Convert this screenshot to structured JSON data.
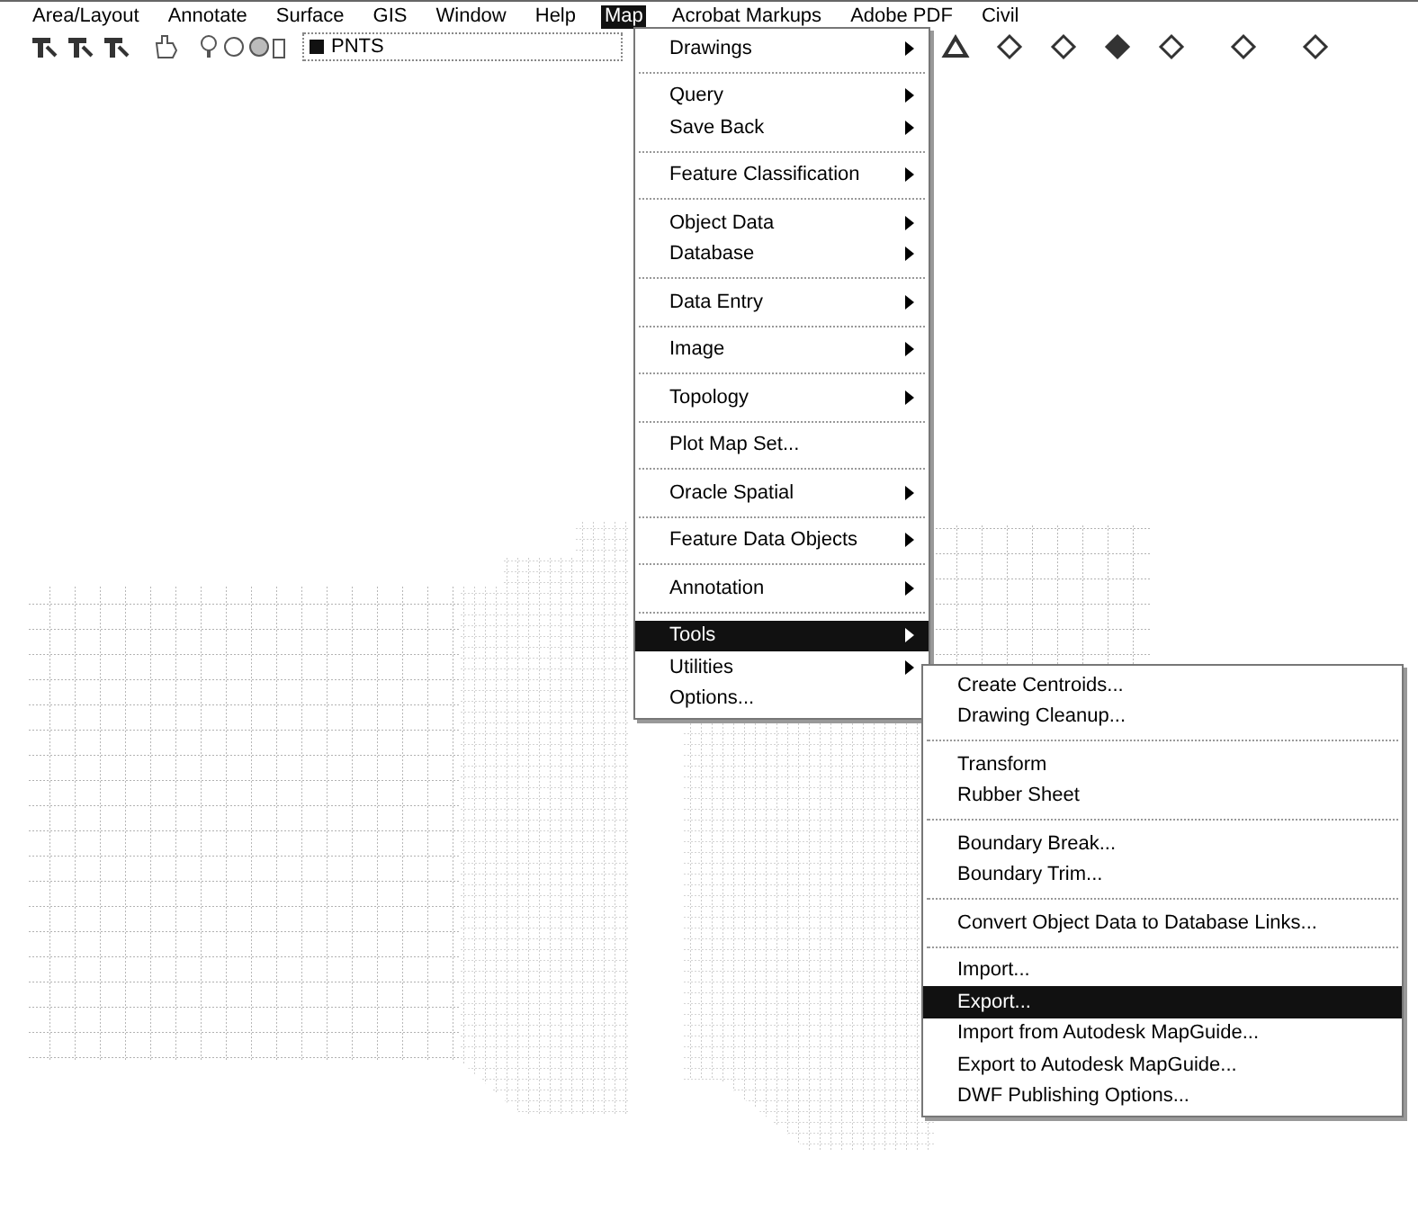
{
  "menubar": [
    {
      "label": "Area/Layout",
      "selected": false
    },
    {
      "label": "Annotate",
      "selected": false
    },
    {
      "label": "Surface",
      "selected": false
    },
    {
      "label": "GIS",
      "selected": false
    },
    {
      "label": "Window",
      "selected": false
    },
    {
      "label": "Help",
      "selected": false
    },
    {
      "label": "Map",
      "selected": true
    },
    {
      "label": "Acrobat Markups",
      "selected": false
    },
    {
      "label": "Adobe PDF",
      "selected": false
    },
    {
      "label": "Civil",
      "selected": false
    }
  ],
  "toolbar": {
    "layer": "PNTS"
  },
  "map_menu": [
    {
      "items": [
        {
          "label": "Drawings",
          "submenu": true,
          "selected": false
        }
      ]
    },
    {
      "items": [
        {
          "label": "Query",
          "submenu": true,
          "selected": false
        },
        {
          "label": "Save Back",
          "submenu": true,
          "selected": false
        }
      ]
    },
    {
      "items": [
        {
          "label": "Feature Classification",
          "submenu": true,
          "selected": false
        }
      ]
    },
    {
      "items": [
        {
          "label": "Object Data",
          "submenu": true,
          "selected": false
        },
        {
          "label": "Database",
          "submenu": true,
          "selected": false
        }
      ]
    },
    {
      "items": [
        {
          "label": "Data Entry",
          "submenu": true,
          "selected": false
        }
      ]
    },
    {
      "items": [
        {
          "label": "Image",
          "submenu": true,
          "selected": false
        }
      ]
    },
    {
      "items": [
        {
          "label": "Topology",
          "submenu": true,
          "selected": false
        }
      ]
    },
    {
      "items": [
        {
          "label": "Plot Map Set...",
          "submenu": false,
          "selected": false
        }
      ]
    },
    {
      "items": [
        {
          "label": "Oracle Spatial",
          "submenu": true,
          "selected": false
        }
      ]
    },
    {
      "items": [
        {
          "label": "Feature Data Objects",
          "submenu": true,
          "selected": false
        }
      ]
    },
    {
      "items": [
        {
          "label": "Annotation",
          "submenu": true,
          "selected": false
        }
      ]
    },
    {
      "items": [
        {
          "label": "Tools",
          "submenu": true,
          "selected": true
        },
        {
          "label": "Utilities",
          "submenu": true,
          "selected": false
        },
        {
          "label": "Options...",
          "submenu": false,
          "selected": false
        }
      ]
    }
  ],
  "tools_submenu": [
    {
      "items": [
        {
          "label": "Create Centroids...",
          "selected": false
        },
        {
          "label": "Drawing Cleanup...",
          "selected": false
        }
      ]
    },
    {
      "items": [
        {
          "label": "Transform",
          "selected": false
        },
        {
          "label": "Rubber Sheet",
          "selected": false
        }
      ]
    },
    {
      "items": [
        {
          "label": "Boundary Break...",
          "selected": false
        },
        {
          "label": "Boundary Trim...",
          "selected": false
        }
      ]
    },
    {
      "items": [
        {
          "label": "Convert Object Data to Database Links...",
          "selected": false
        }
      ]
    },
    {
      "items": [
        {
          "label": "Import...",
          "selected": false
        },
        {
          "label": "Export...",
          "selected": true
        },
        {
          "label": "Import from Autodesk MapGuide...",
          "selected": false
        },
        {
          "label": "Export to Autodesk MapGuide...",
          "selected": false
        },
        {
          "label": "DWF Publishing Options...",
          "selected": false
        }
      ]
    }
  ]
}
